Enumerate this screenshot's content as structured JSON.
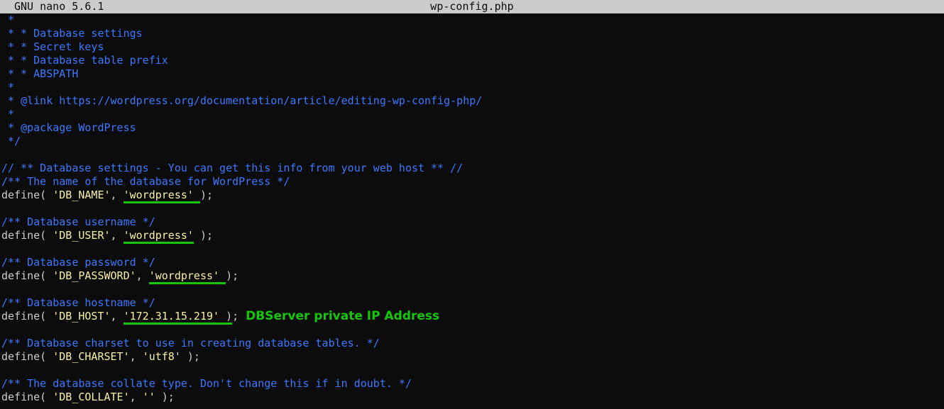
{
  "titlebar": {
    "app": "GNU nano 5.6.1",
    "filename": "wp-config.php"
  },
  "lines": {
    "l0": " *",
    "l1": " * * Database settings",
    "l2": " * * Secret keys",
    "l3": " * * Database table prefix",
    "l4": " * * ABSPATH",
    "l5": " *",
    "l6": " * @link https://wordpress.org/documentation/article/editing-wp-config-php/",
    "l7": " *",
    "l8": " * @package WordPress",
    "l9": " */",
    "l11": "// ** Database settings - You can get this info from your web host ** //",
    "l12": "/** The name of the database for WordPress */",
    "l15": "/** Database username */",
    "l18": "/** Database password */",
    "l21": "/** Database hostname */",
    "l24": "/** Database charset to use in creating database tables. */",
    "l27": "/** The database collate type. Don't change this if in doubt. */"
  },
  "defines": {
    "db_name": {
      "prefix": "define( ",
      "key": "'DB_NAME'",
      "sep": ", ",
      "value": "'wordpress'",
      "suffix": " );"
    },
    "db_user": {
      "prefix": "define( ",
      "key": "'DB_USER'",
      "sep": ", ",
      "value": "'wordpress'",
      "suffix": " );"
    },
    "db_password": {
      "prefix": "define( ",
      "key": "'DB_PASSWORD'",
      "sep": ", ",
      "value": "'wordpress'",
      "suffix": " );"
    },
    "db_host": {
      "prefix": "define( ",
      "key": "'DB_HOST'",
      "sep": ", ",
      "value": "'172.31.15.219'",
      "suffix": " );"
    },
    "db_charset": {
      "prefix": "define( ",
      "key": "'DB_CHARSET'",
      "sep": ", ",
      "value": "'utf8'",
      "suffix": " );"
    },
    "db_collate": {
      "prefix": "define( ",
      "key": "'DB_COLLATE'",
      "sep": ", ",
      "value": "''",
      "suffix": " );"
    }
  },
  "annotation": "DBServer private IP Address",
  "colors": {
    "background": "#0c0c0c",
    "comment": "#3b78ff",
    "string": "#f9f1a5",
    "plain": "#cccccc",
    "highlight": "#16c60c",
    "titlebar": "#cccccc"
  }
}
